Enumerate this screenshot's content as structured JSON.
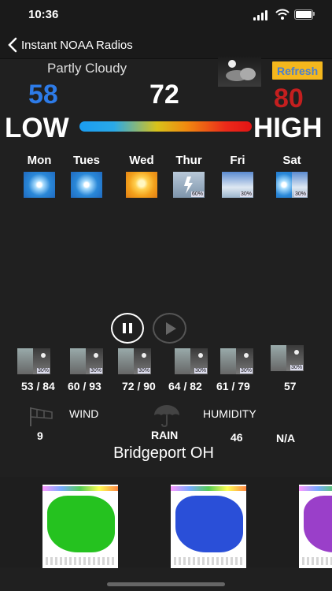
{
  "status_bar": {
    "time": "10:36"
  },
  "nav": {
    "back_label": "Instant NOAA Radios"
  },
  "current": {
    "condition": "Partly Cloudy",
    "refresh_label": "Refresh",
    "low": "58",
    "now": "72",
    "high": "80",
    "low_word": "LOW",
    "high_word": "HIGH"
  },
  "days": [
    {
      "name": "Mon",
      "icon": "sunny"
    },
    {
      "name": "Tues",
      "icon": "sunny"
    },
    {
      "name": "Wed",
      "icon": "hot"
    },
    {
      "name": "Thur",
      "icon": "thunderstorm",
      "pct": "60%"
    },
    {
      "name": "Fri",
      "icon": "cloudy",
      "pct": "30%"
    },
    {
      "name": "Sat",
      "icon": "sunny-and-cloudy",
      "pct": "30%"
    }
  ],
  "hourly": [
    {
      "pct": "30%",
      "range": "53 / 84"
    },
    {
      "pct": "30%",
      "range": "60 / 93"
    },
    {
      "pct": "30%",
      "range": "72 / 90"
    },
    {
      "pct": "30%",
      "range": "64 / 82"
    },
    {
      "pct": "30%",
      "range": "61 / 79"
    },
    {
      "pct": "30%",
      "range": "57"
    }
  ],
  "details": {
    "wind_label": "WIND",
    "humidity_label": "HUMIDITY",
    "rain_label": "RAIN",
    "wind_value": "9",
    "humidity_value": "46",
    "na_value": "N/A"
  },
  "location": "Bridgeport OH",
  "maps": [
    {
      "color": "#25c21f"
    },
    {
      "color": "#2a4fd8"
    },
    {
      "color": "#9a3fc9"
    }
  ],
  "colors": {
    "low": "#2d7be8",
    "high": "#c41f1f",
    "refresh_bg": "#f4b71d",
    "refresh_text": "#4a7fd0"
  }
}
